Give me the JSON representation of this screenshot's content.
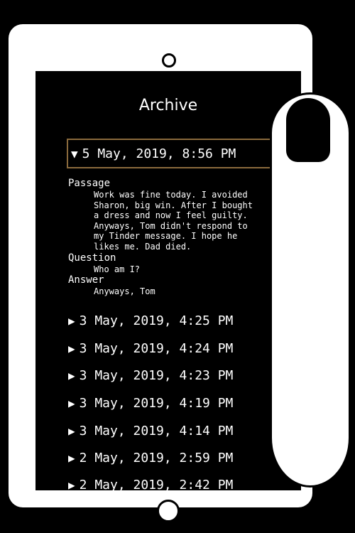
{
  "archive": {
    "title": "Archive",
    "expanded": {
      "timestamp": "5 May, 2019, 8:56 PM",
      "passage_label": "Passage",
      "passage_lines": [
        "Work was fine today. I avoided",
        "Sharon, big win. After I bought",
        "a dress and now I feel guilty.",
        "Anyways, Tom didn't respond to",
        "my Tinder message. I hope he",
        "likes me. Dad died."
      ],
      "question_label": "Question",
      "question": "Who am I?",
      "answer_label": "Answer",
      "answer": "Anyways, Tom"
    },
    "entries": [
      "3 May, 2019, 4:25 PM",
      "3 May, 2019, 4:24 PM",
      "3 May, 2019, 4:23 PM",
      "3 May, 2019, 4:19 PM",
      "3 May, 2019, 4:14 PM",
      "2 May, 2019, 2:59 PM",
      "2 May, 2019, 2:42 PM"
    ]
  },
  "icons": {
    "collapse": "triangle-down-icon",
    "expand": "triangle-right-icon"
  },
  "colors": {
    "background": "#000000",
    "device": "#ffffff",
    "selected_border": "#8a6a3c"
  }
}
